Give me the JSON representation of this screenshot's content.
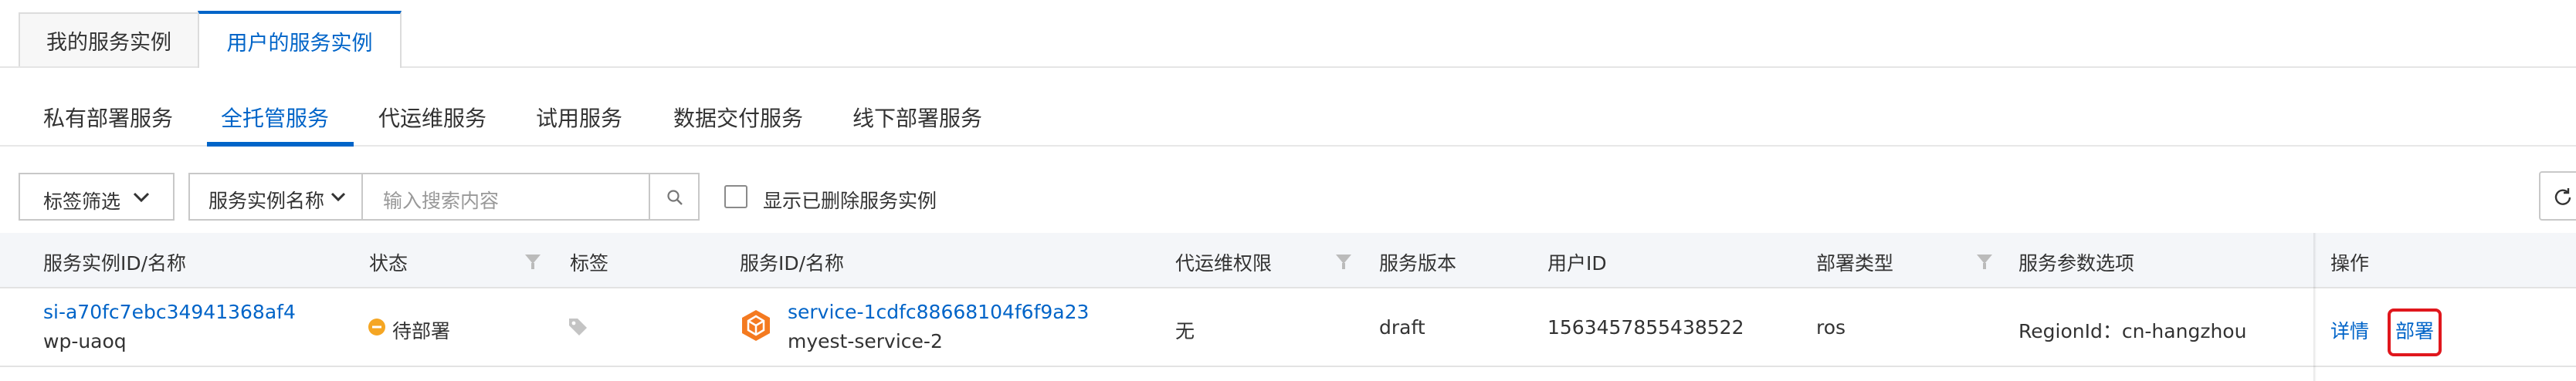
{
  "top_tabs": [
    {
      "label": "我的服务实例",
      "active": false
    },
    {
      "label": "用户的服务实例",
      "active": true
    }
  ],
  "sub_tabs": [
    {
      "label": "私有部署服务",
      "active": false
    },
    {
      "label": "全托管服务",
      "active": true
    },
    {
      "label": "代运维服务",
      "active": false
    },
    {
      "label": "试用服务",
      "active": false
    },
    {
      "label": "数据交付服务",
      "active": false
    },
    {
      "label": "线下部署服务",
      "active": false
    }
  ],
  "filters": {
    "tag_filter_label": "标签筛选",
    "search_field_label": "服务实例名称",
    "search_placeholder": "输入搜索内容",
    "show_deleted_label": "显示已删除服务实例",
    "show_deleted_checked": false
  },
  "table": {
    "columns": [
      "服务实例ID/名称",
      "状态",
      "标签",
      "服务ID/名称",
      "代运维权限",
      "服务版本",
      "用户ID",
      "部署类型",
      "服务参数选项",
      "操作"
    ],
    "rows": [
      {
        "instance_id": "si-a70fc7ebc34941368af4",
        "instance_name": "wp-uaoq",
        "status": "待部署",
        "service_id": "service-1cdfc88668104f6f9a23",
        "service_name": "myest-service-2",
        "ops_permission": "无",
        "service_version": "draft",
        "user_id": "1563457855438522",
        "deploy_type": "ros",
        "param_options": "RegionId：cn-hangzhou",
        "actions": [
          "详情",
          "部署"
        ]
      }
    ]
  },
  "colors": {
    "accent": "#0064c8",
    "status_pending": "#f5a623",
    "highlight_box": "#e0171d",
    "service_icon": "#f47a20"
  },
  "icons": {
    "tag_filter_chevron": "chevron-down-icon",
    "search_field_chevron": "chevron-down-icon",
    "search_button": "search-icon",
    "refresh_button": "refresh-icon",
    "column_filter": "filter-icon",
    "tag_cell": "tag-icon",
    "service_icon": "hexagon-service-icon",
    "status_icon": "minus-circle-icon"
  }
}
